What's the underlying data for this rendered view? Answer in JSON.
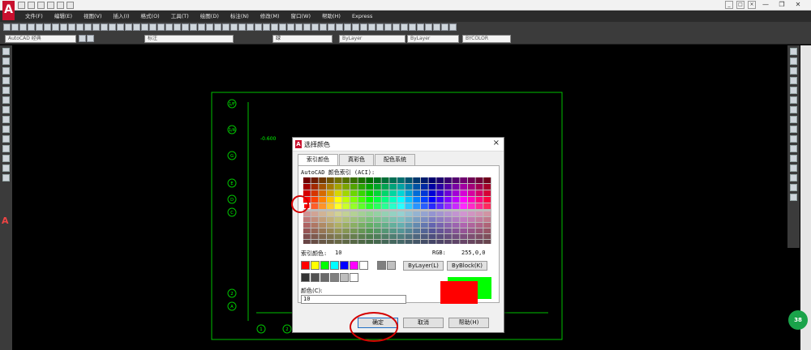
{
  "app": {
    "logo": "A"
  },
  "menu": [
    "文件(F)",
    "编辑(E)",
    "视图(V)",
    "插入(I)",
    "格式(O)",
    "工具(T)",
    "绘图(D)",
    "标注(N)",
    "修改(M)",
    "窗口(W)",
    "帮助(H)",
    "Express"
  ],
  "toolbar2": {
    "workspace": "AutoCAD 经典",
    "layer": "标注",
    "color": "绿",
    "linetype": "ByLayer",
    "lineweight": "ByLayer",
    "plotstyle": "BYCOLOR"
  },
  "drawing": {
    "labels": [
      "1/F",
      "1/A",
      "G",
      "E",
      "D",
      "C",
      "2",
      "A",
      "1",
      "2"
    ],
    "elevation": "-0.600"
  },
  "dialog": {
    "title": "选择颜色",
    "close": "×",
    "tabs": [
      "索引颜色",
      "真彩色",
      "配色系统"
    ],
    "aci_label": "AutoCAD 颜色索引 (ACI):",
    "index_label": "索引颜色:",
    "index_value": "10",
    "rgb_label": "RGB:",
    "rgb_value": "255,0,0",
    "bylayer": "ByLayer(L)",
    "byblock": "ByBlock(K)",
    "color_label": "颜色(C):",
    "color_value": "10",
    "ok": "确定",
    "cancel": "取消",
    "help": "帮助(H)",
    "std_colors": [
      "#ff0000",
      "#ffff00",
      "#00ff00",
      "#00ffff",
      "#0000ff",
      "#ff00ff",
      "#ffffff",
      "#808080",
      "#c0c0c0"
    ],
    "gray_colors": [
      "#333333",
      "#505050",
      "#696969",
      "#808080",
      "#bebebe",
      "#ffffff"
    ],
    "preview_old": "#00ff00",
    "preview_new": "#ff0000"
  },
  "badge": "38"
}
